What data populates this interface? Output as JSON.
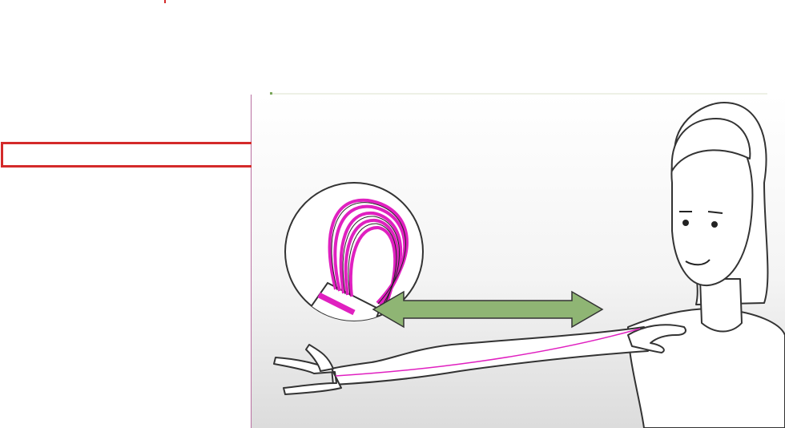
{
  "colors": {
    "accent": "#d42a2a",
    "magenta_bundle": "#e020c0",
    "arrow_green": "#8fb574",
    "skin_line": "#333333"
  },
  "illustration": {
    "icons": [
      "fiber-bundle-icon",
      "double-arrow-icon",
      "woman-arm-measurement-icon"
    ]
  }
}
